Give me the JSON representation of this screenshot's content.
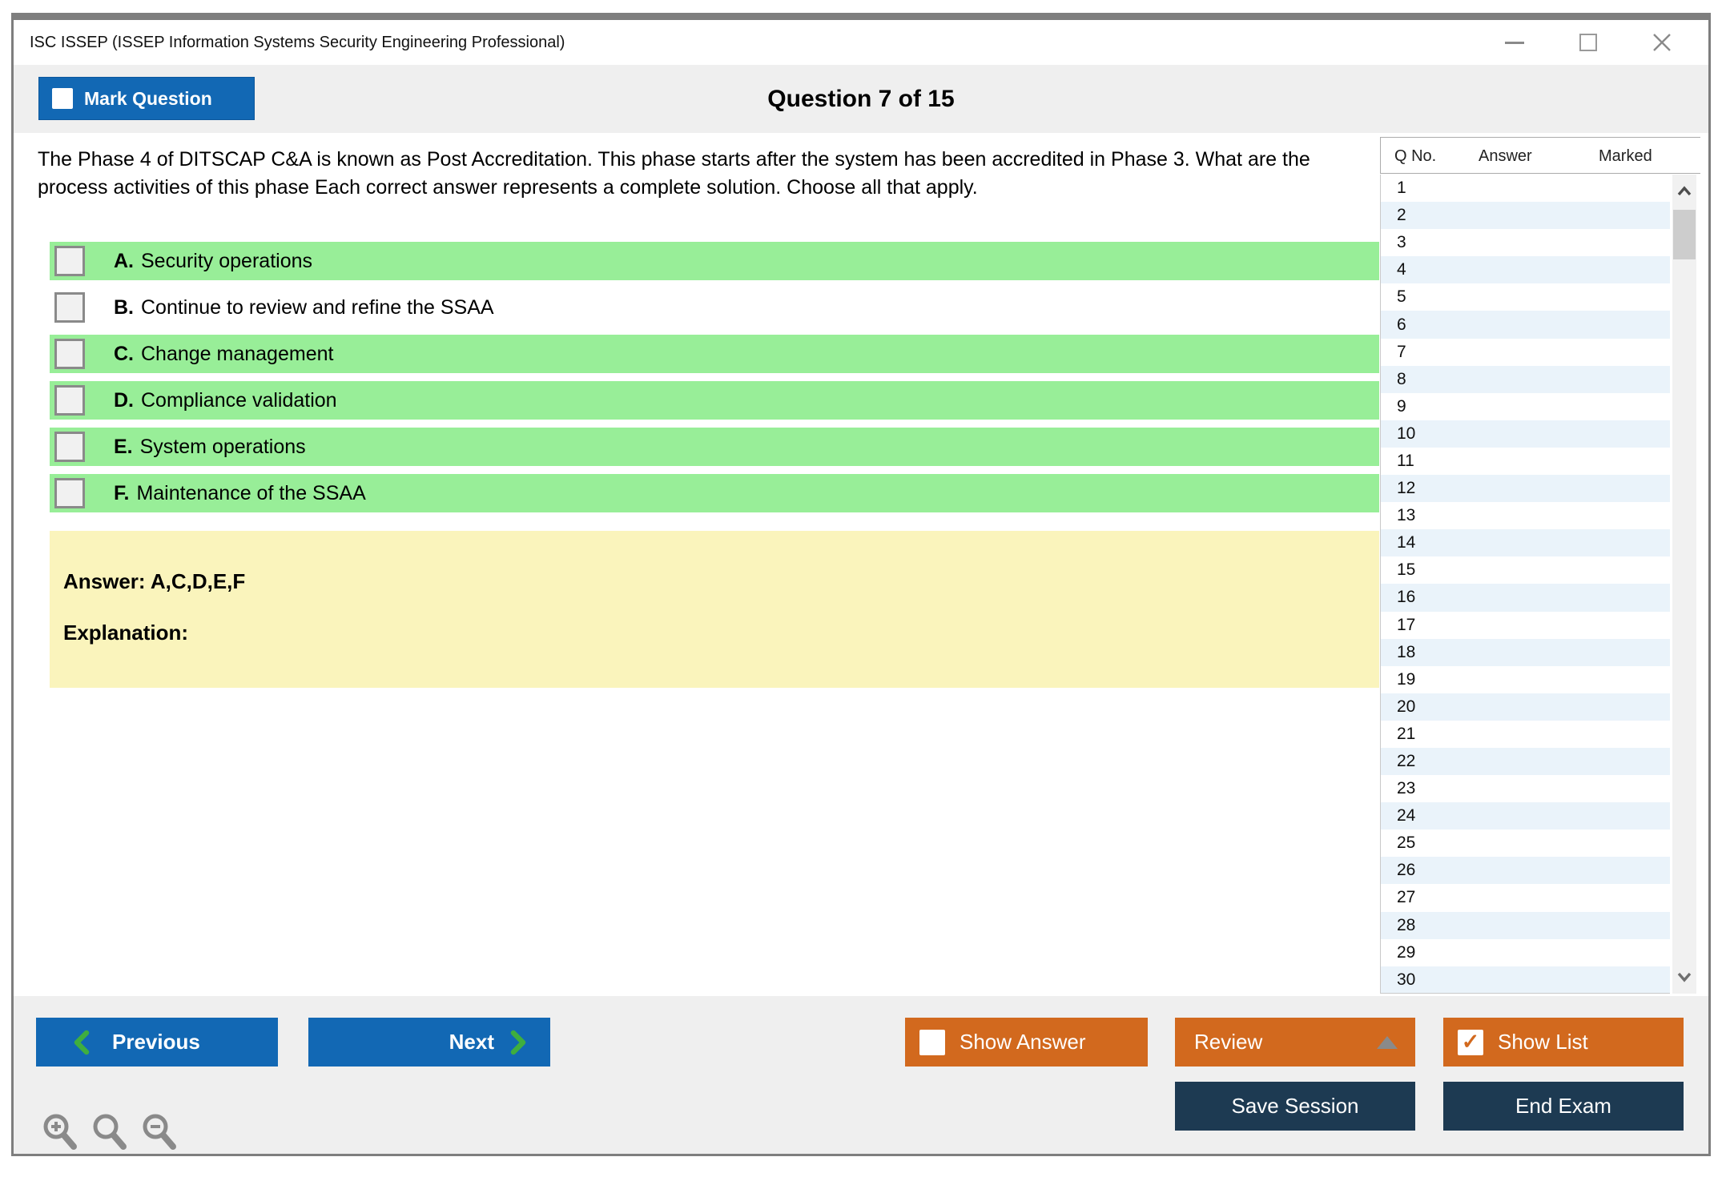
{
  "window": {
    "title": "ISC ISSEP (ISSEP Information Systems Security Engineering Professional)"
  },
  "header": {
    "mark_question_label": "Mark Question",
    "mark_question_checked": false,
    "question_counter": "Question 7 of 15"
  },
  "question": {
    "text": "The Phase 4 of DITSCAP C&A is known as Post Accreditation. This phase starts after the system has been accredited in Phase 3. What are the process activities of this phase Each correct answer represents a complete solution. Choose all that apply.",
    "options": [
      {
        "letter": "A.",
        "text": "Security operations",
        "highlighted": true,
        "checked": false
      },
      {
        "letter": "B.",
        "text": "Continue to review and refine the SSAA",
        "highlighted": false,
        "checked": false
      },
      {
        "letter": "C.",
        "text": "Change management",
        "highlighted": true,
        "checked": false
      },
      {
        "letter": "D.",
        "text": "Compliance validation",
        "highlighted": true,
        "checked": false
      },
      {
        "letter": "E.",
        "text": "System operations",
        "highlighted": true,
        "checked": false
      },
      {
        "letter": "F.",
        "text": "Maintenance of the SSAA",
        "highlighted": true,
        "checked": false
      }
    ],
    "answer_label": "Answer: A,C,D,E,F",
    "explanation_label": "Explanation:"
  },
  "sidebar": {
    "columns": {
      "qno": "Q No.",
      "answer": "Answer",
      "marked": "Marked"
    },
    "row_numbers": [
      1,
      2,
      3,
      4,
      5,
      6,
      7,
      8,
      9,
      10,
      11,
      12,
      13,
      14,
      15,
      16,
      17,
      18,
      19,
      20,
      21,
      22,
      23,
      24,
      25,
      26,
      27,
      28,
      29,
      30
    ],
    "rows_answer": "",
    "rows_marked": ""
  },
  "footer": {
    "previous_label": "Previous",
    "next_label": "Next",
    "show_answer_label": "Show Answer",
    "show_answer_checked": false,
    "review_label": "Review",
    "show_list_label": "Show List",
    "show_list_checked": true,
    "save_session_label": "Save Session",
    "end_exam_label": "End Exam"
  },
  "icons": {
    "check_glyph": "✓"
  },
  "colors": {
    "primary_blue": "#1268b4",
    "option_highlight_green": "#98ee98",
    "answer_box_yellow": "#faf4bc",
    "accent_orange": "#d2691e",
    "navy": "#1d3a52",
    "list_stripe_blue": "#eaf3fa",
    "chevron_green": "#3fae3f"
  }
}
